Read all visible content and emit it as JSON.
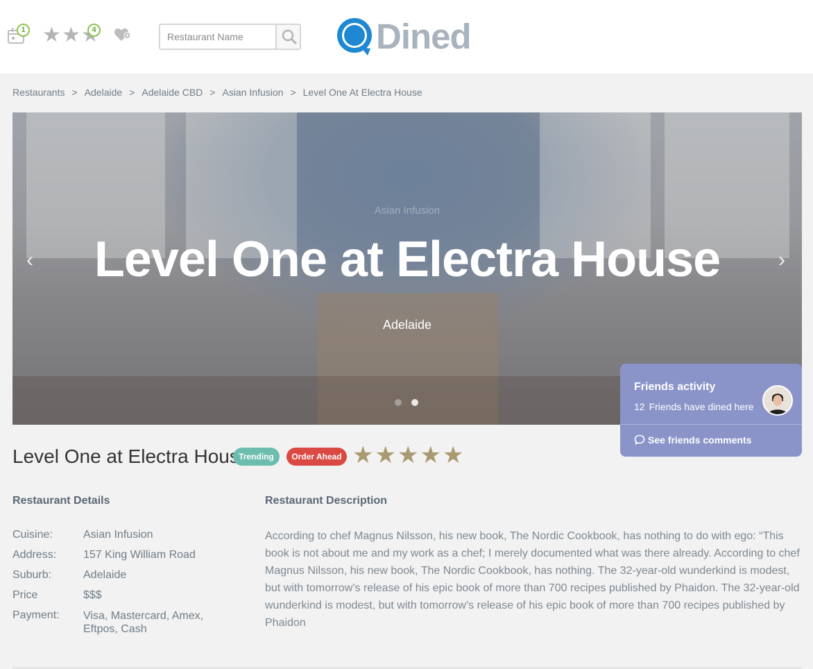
{
  "header": {
    "calendar_badge": "1",
    "stars_badge": "4",
    "search": {
      "placeholder": "Restaurant Name"
    },
    "logo": {
      "text": "Dined",
      "brand_color": "#1e88d2",
      "text_color": "#a9b3be"
    },
    "icons": [
      "calendar-icon",
      "star-icon",
      "heart-plus-icon",
      "search-icon"
    ]
  },
  "breadcrumb": [
    "Restaurants",
    "Adelaide",
    "Adelaide CBD",
    "Asian Infusion",
    "Level One At Electra House"
  ],
  "breadcrumb_separator": ">",
  "hero": {
    "subtitle": "Asian Infusion",
    "title": "Level One at Electra House",
    "city": "Adelaide",
    "prev_arrow": "‹",
    "next_arrow": "›",
    "slides": 2,
    "active_slide": 2
  },
  "friends": {
    "title": "Friends activity",
    "count": "12",
    "count_text": "Friends have dined here",
    "link": "See friends comments",
    "card_color": "#8b94c9"
  },
  "restaurant": {
    "name": "Level One at Electra House",
    "tags": [
      {
        "label": "Trending",
        "color": "#6cbdae"
      },
      {
        "label": "Order Ahead",
        "color": "#da4a43"
      }
    ],
    "rating_stars": 5,
    "star_color": "#a99a72"
  },
  "details": {
    "title": "Restaurant Details",
    "rows": [
      {
        "label": "Cuisine:",
        "value": "Asian Infusion"
      },
      {
        "label": "Address:",
        "value": "157 King William Road"
      },
      {
        "label": "Suburb:",
        "value": "Adelaide"
      },
      {
        "label": "Price",
        "value": "$$$"
      },
      {
        "label": "Payment:",
        "value": "Visa, Mastercard, Amex, Eftpos, Cash"
      }
    ]
  },
  "description": {
    "title": "Restaurant Description",
    "text": "According to chef Magnus Nilsson, his new book, The Nordic Cookbook, has nothing to do with ego: “This book is not about me and my work as a chef; I merely documented what was there already. According to chef Magnus Nilsson, his new book, The Nordic Cookbook, has nothing. The 32-year-old wunderkind is modest, but with tomorrow’s release of his epic book of more than 700 recipes published by Phaidon. The 32-year-old wunderkind is modest, but with tomorrow’s release of his epic book of more than 700 recipes published by Phaidon"
  }
}
